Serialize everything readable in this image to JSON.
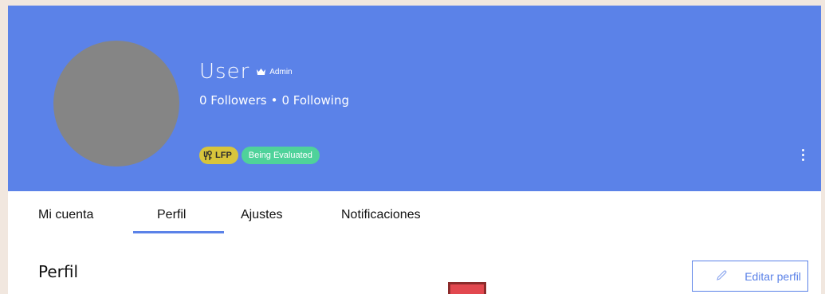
{
  "profile": {
    "name": "User",
    "role_label": "Admin",
    "followers_text": "0 Followers",
    "separator": "•",
    "following_text": "0 Following",
    "badges": {
      "lfp_label": "LFP",
      "status_label": "Being Evaluated"
    }
  },
  "tabs": [
    {
      "label": "Mi cuenta"
    },
    {
      "label": "Perfil",
      "active": true
    },
    {
      "label": "Ajustes"
    },
    {
      "label": "Notificaciones"
    }
  ],
  "section": {
    "title": "Perfil",
    "edit_label": "Editar perfil"
  },
  "colors": {
    "banner": "#5b82e8",
    "avatar": "#858585",
    "lfp_badge": "#d8c53b",
    "status_badge": "#4fd29a",
    "accent": "#5b82e8"
  },
  "icons": {
    "role": "crown-icon",
    "lfp": "lfp-icon",
    "menu": "more-vertical-icon",
    "edit": "pencil-icon"
  }
}
